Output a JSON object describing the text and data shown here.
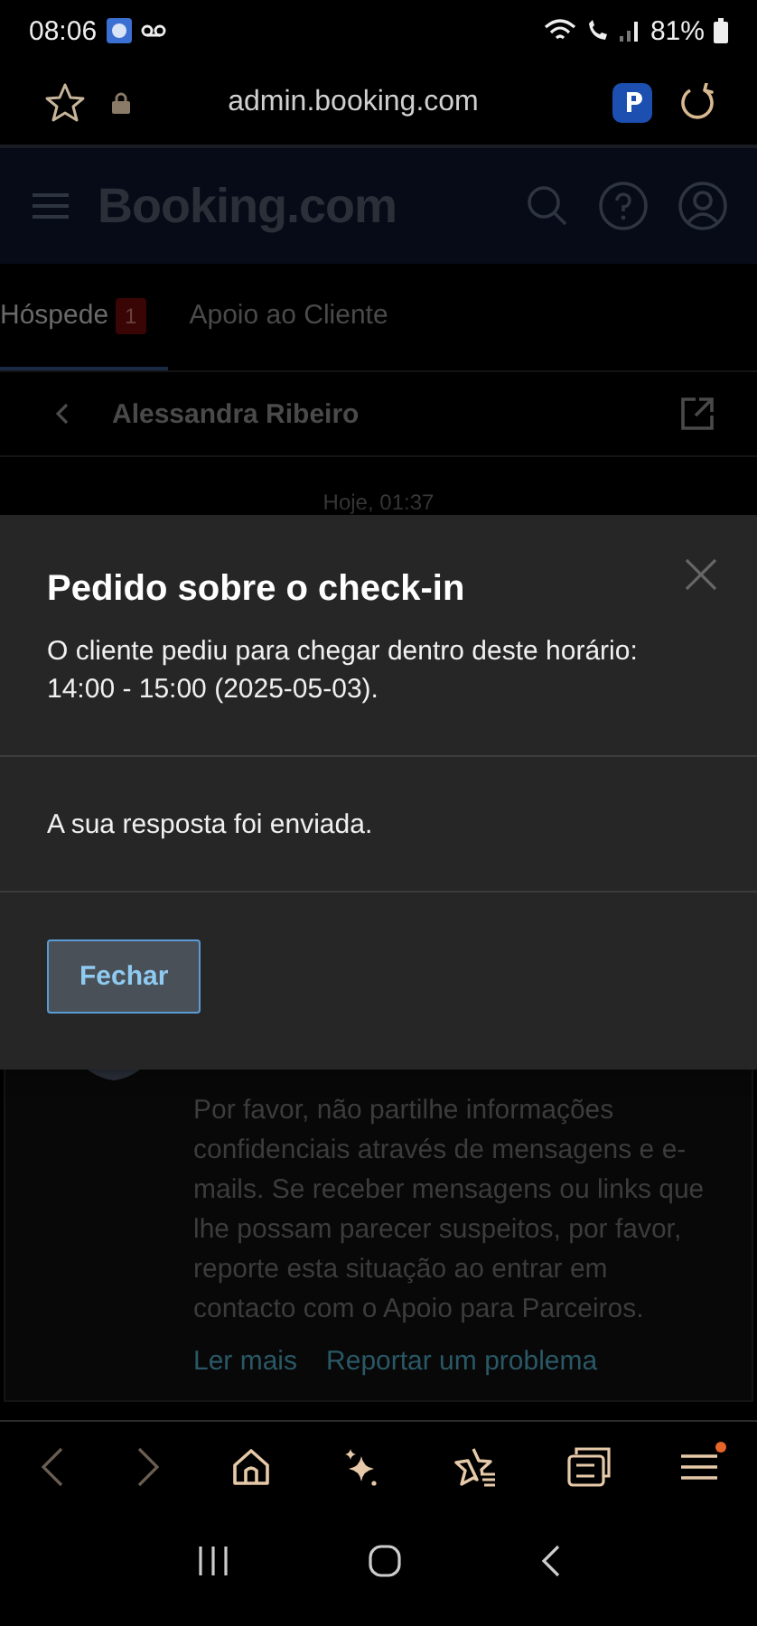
{
  "status_bar": {
    "time": "08:06",
    "battery": "81%"
  },
  "browser": {
    "url": "admin.booking.com",
    "menu_notification": true
  },
  "header": {
    "logo": "Booking.com"
  },
  "tabs": [
    {
      "label": "Hóspede",
      "badge": "1",
      "selected": true
    },
    {
      "label": "Apoio ao Cliente",
      "selected": false
    }
  ],
  "conversation": {
    "guest": "Alessandra Ribeiro",
    "date": "Hoje, 01:37"
  },
  "modal": {
    "title": "Pedido sobre o check-in",
    "message": "O cliente pediu para chegar dentro deste horário: 14:00 - 15:00 (2025-05-03).",
    "status": "A sua resposta foi enviada.",
    "button": "Fechar"
  },
  "notice": {
    "text": "Por favor, não partilhe informações confidenciais através de mensagens e e-mails. Se receber mensagens ou links que lhe possam parecer suspeitos, por favor, reporte esta situação ao entrar em contacto com o Apoio para Parceiros.",
    "links": [
      "Ler mais",
      "Reportar um problema"
    ]
  }
}
